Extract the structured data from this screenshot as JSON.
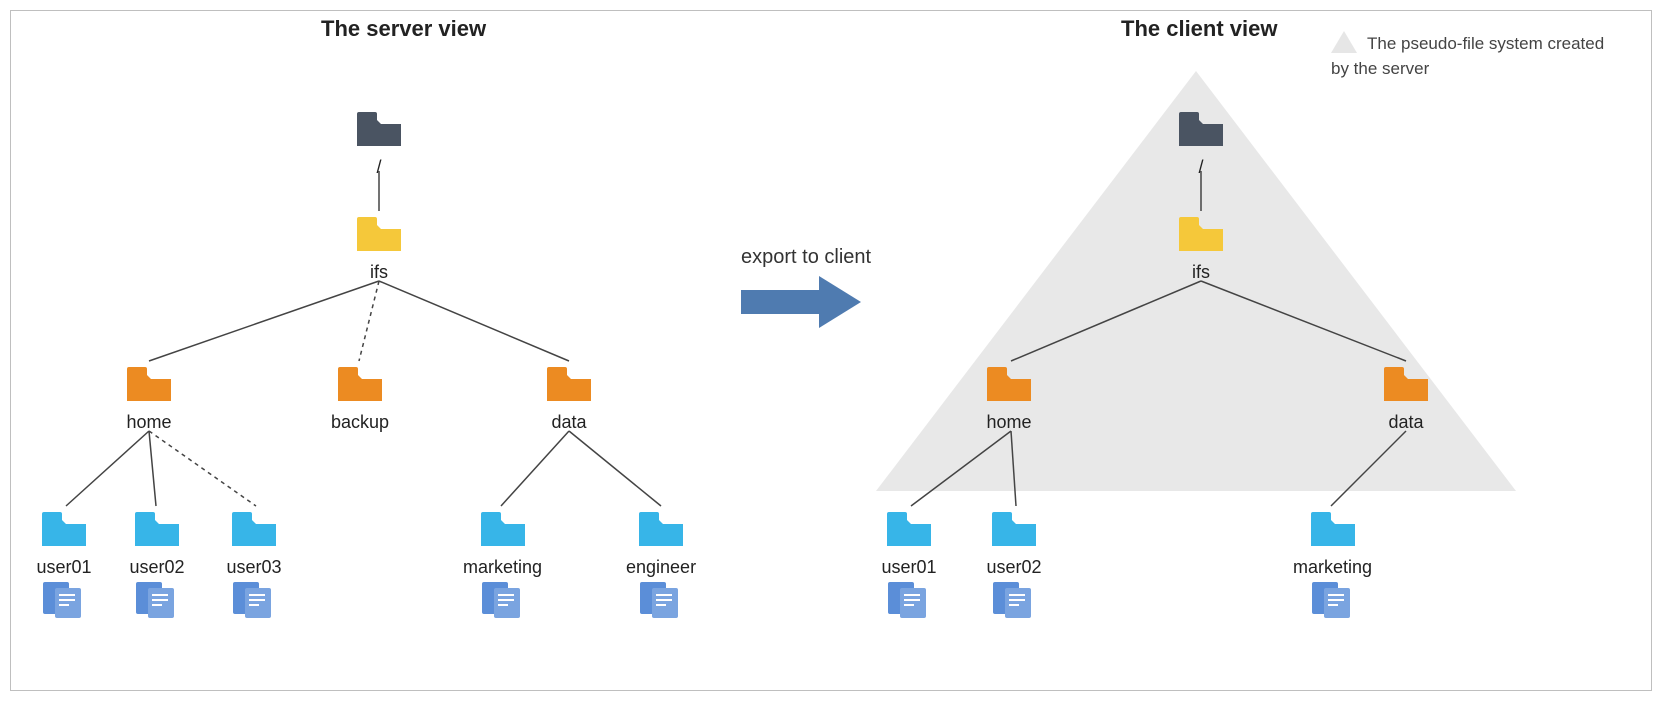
{
  "titles": {
    "server": "The server view",
    "client": "The client view"
  },
  "arrow_label": "export to client",
  "legend": "The pseudo-file system created by the server",
  "nodes": {
    "root": "/",
    "ifs": "ifs",
    "home": "home",
    "backup": "backup",
    "data": "data",
    "user01": "user01",
    "user02": "user02",
    "user03": "user03",
    "marketing": "marketing",
    "engineer": "engineer"
  },
  "colors": {
    "dark": "#4a5462",
    "yellow": "#f5c83a",
    "orange": "#ec8b22",
    "blue": "#37b5e8",
    "doc": "#5b8ed8",
    "arrow": "#4f7bb0"
  }
}
